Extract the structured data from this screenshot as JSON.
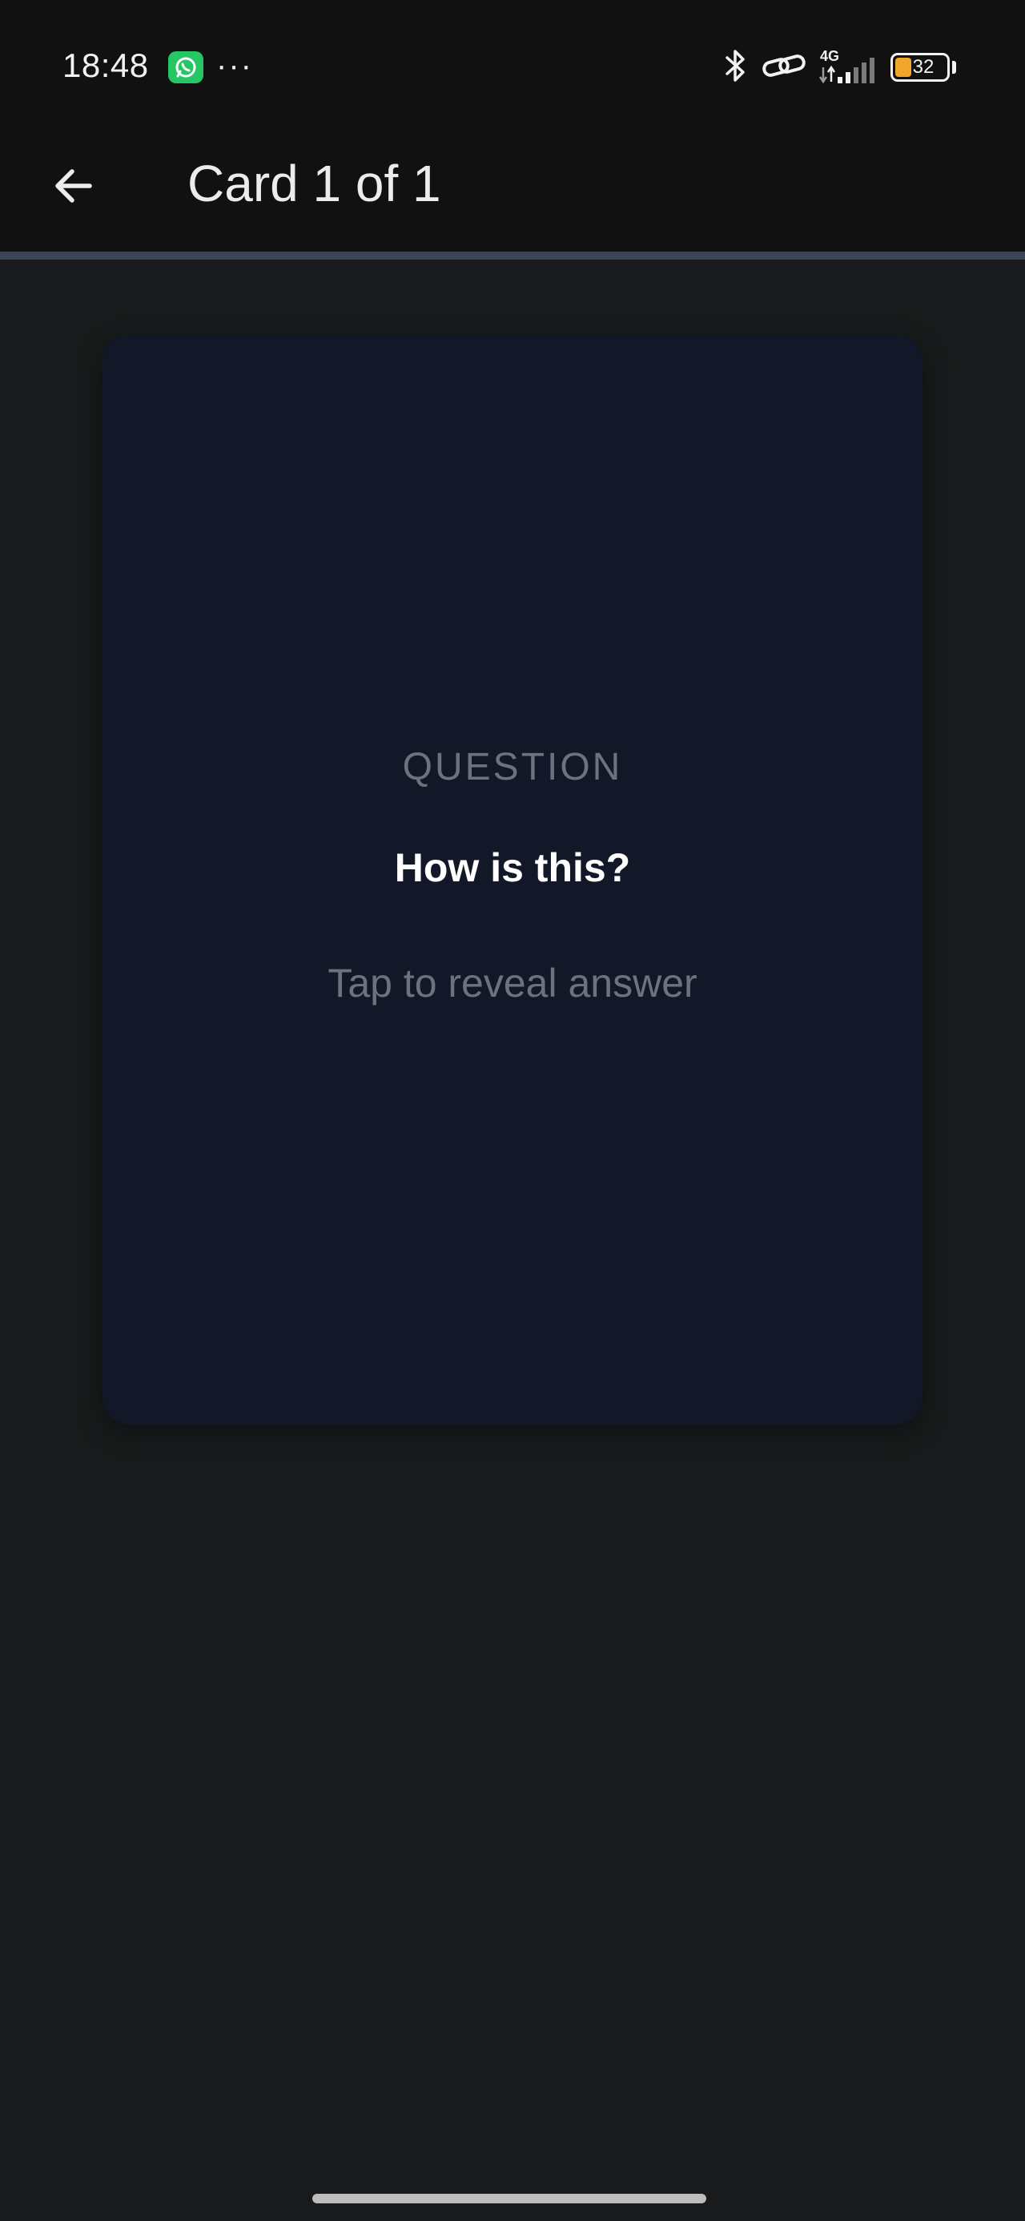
{
  "status_bar": {
    "time": "18:48",
    "notification_app_icon": "whatsapp-icon",
    "more_indicator": "···",
    "network_label": "4G",
    "battery_level": "32",
    "battery_fraction": 0.32,
    "icons": [
      "bluetooth-icon",
      "link-icon",
      "signal-icon",
      "battery-icon"
    ]
  },
  "app_bar": {
    "back_icon": "arrow-left-icon",
    "title": "Card 1 of 1"
  },
  "progress": {
    "current": 1,
    "total": 1,
    "color": "#3a4654"
  },
  "card": {
    "label": "QUESTION",
    "question": "How is this?",
    "hint": "Tap to reveal answer",
    "background": "#131828"
  },
  "colors": {
    "background": "#181a1b",
    "bar": "#111111",
    "muted_text": "#6b7280"
  }
}
